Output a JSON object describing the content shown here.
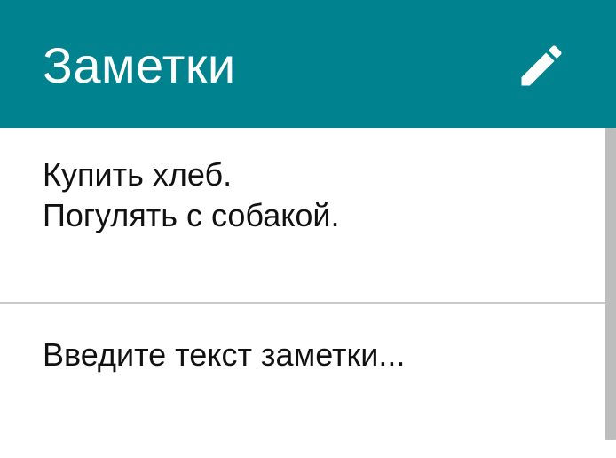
{
  "theme": {
    "accent": "#00838f",
    "divider": "#c8c8c8",
    "scrollbar": "#bdbdbd"
  },
  "appbar": {
    "title": "Заметки",
    "edit_icon": "pencil-icon"
  },
  "notes": [
    {
      "text": "Купить хлеб.\nПогулять с собакой."
    }
  ],
  "input": {
    "placeholder": "Введите текст заметки..."
  }
}
